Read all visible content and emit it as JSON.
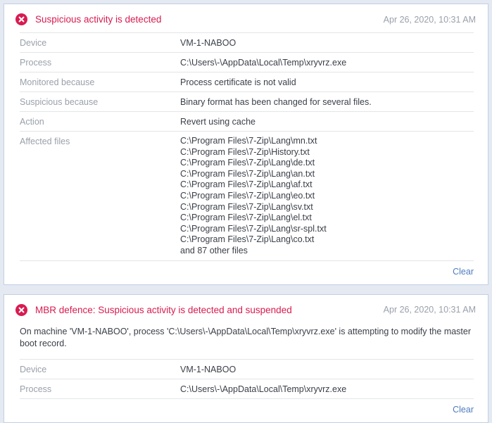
{
  "theme": {
    "page_background": "#e4e9f2",
    "card_background": "#ffffff",
    "card_border": "#c2cfe3",
    "alert_accent": "#d81b50",
    "link_color": "#4d7cc0",
    "label_color": "#9aa0aa",
    "value_color": "#3a3f47",
    "separator_color": "#e3e5e8"
  },
  "alerts": [
    {
      "icon": "error-circle-icon",
      "title": "Suspicious activity is detected",
      "timestamp": "Apr 26, 2020, 10:31 AM",
      "description": null,
      "rows": [
        {
          "label": "Device",
          "value": "VM-1-NABOO"
        },
        {
          "label": "Process",
          "value": "C:\\Users\\-\\AppData\\Local\\Temp\\xryvrz.exe"
        },
        {
          "label": "Monitored because",
          "value": "Process certificate is not valid"
        },
        {
          "label": "Suspicious because",
          "value": "Binary format has been changed for several files."
        },
        {
          "label": "Action",
          "value": "Revert using cache"
        },
        {
          "label": "Affected files",
          "value_list": [
            "C:\\Program Files\\7-Zip\\Lang\\mn.txt",
            "C:\\Program Files\\7-Zip\\History.txt",
            "C:\\Program Files\\7-Zip\\Lang\\de.txt",
            "C:\\Program Files\\7-Zip\\Lang\\an.txt",
            "C:\\Program Files\\7-Zip\\Lang\\af.txt",
            "C:\\Program Files\\7-Zip\\Lang\\eo.txt",
            "C:\\Program Files\\7-Zip\\Lang\\sv.txt",
            "C:\\Program Files\\7-Zip\\Lang\\el.txt",
            "C:\\Program Files\\7-Zip\\Lang\\sr-spl.txt",
            "C:\\Program Files\\7-Zip\\Lang\\co.txt",
            "and 87 other files"
          ]
        }
      ],
      "clear_label": "Clear"
    },
    {
      "icon": "error-circle-icon",
      "title": "MBR defence: Suspicious activity is detected and suspended",
      "timestamp": "Apr 26, 2020, 10:31 AM",
      "description": "On machine 'VM-1-NABOO', process 'C:\\Users\\-\\AppData\\Local\\Temp\\xryvrz.exe' is attempting to modify the master boot record.",
      "rows": [
        {
          "label": "Device",
          "value": "VM-1-NABOO"
        },
        {
          "label": "Process",
          "value": "C:\\Users\\-\\AppData\\Local\\Temp\\xryvrz.exe"
        }
      ],
      "clear_label": "Clear"
    }
  ]
}
